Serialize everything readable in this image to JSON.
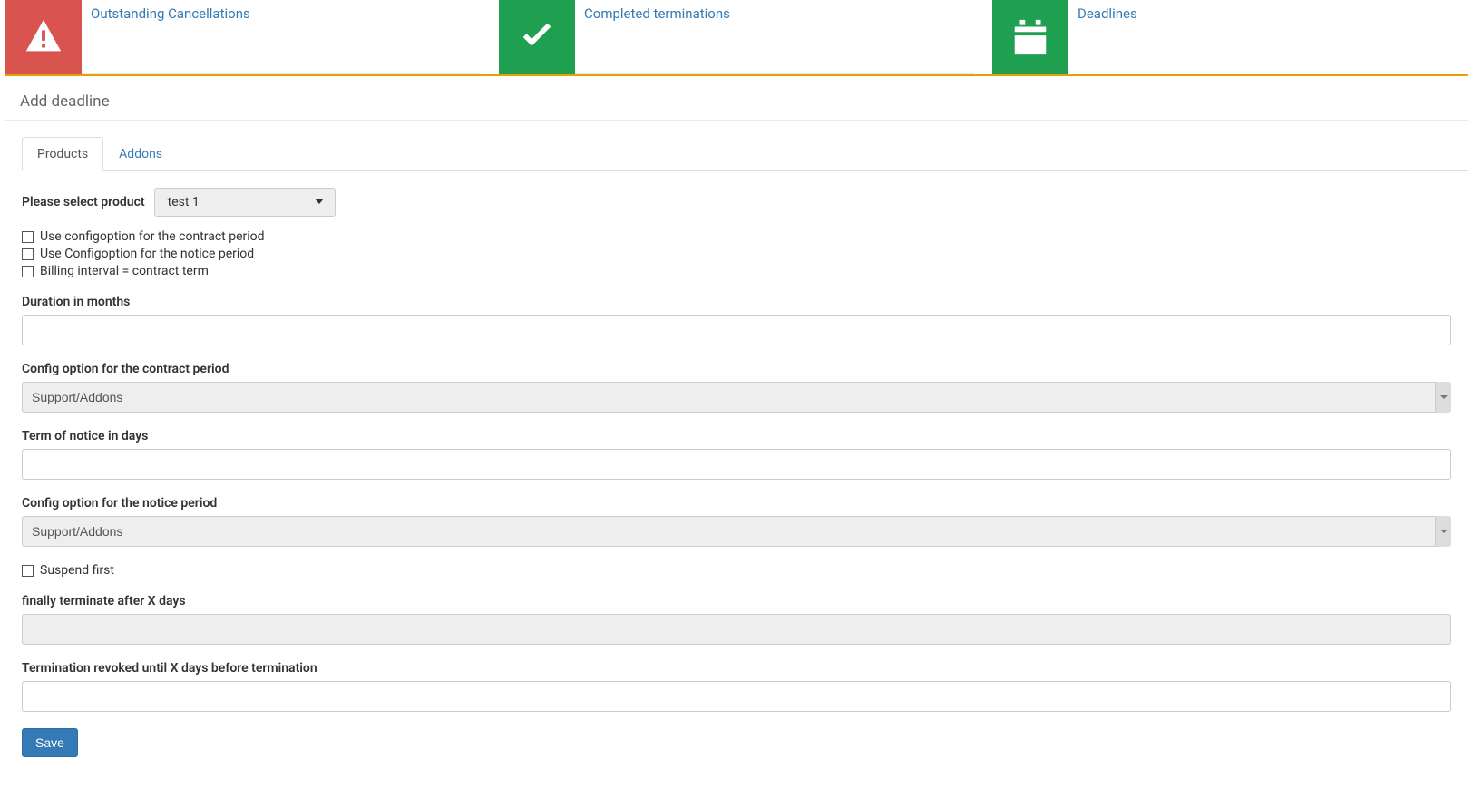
{
  "cards": {
    "outstanding": {
      "title": "Outstanding Cancellations"
    },
    "completed": {
      "title": "Completed terminations"
    },
    "deadlines": {
      "title": "Deadlines"
    }
  },
  "panel": {
    "heading": "Add deadline"
  },
  "tabs": {
    "products": "Products",
    "addons": "Addons"
  },
  "form": {
    "select_product_label": "Please select product",
    "select_product_value": "test 1",
    "chk_config_contract": "Use configoption for the contract period",
    "chk_config_notice": "Use Configoption for the notice period",
    "chk_billing_interval": "Billing interval = contract term",
    "duration_label": "Duration in months",
    "duration_value": "",
    "config_contract_label": "Config option for the contract period",
    "config_contract_value": "Support/Addons",
    "term_notice_label": "Term of notice in days",
    "term_notice_value": "",
    "config_notice_label": "Config option for the notice period",
    "config_notice_value": "Support/Addons",
    "chk_suspend_first": "Suspend first",
    "finally_terminate_label": "finally terminate after X days",
    "finally_terminate_value": "",
    "revoked_label": "Termination revoked until X days before termination",
    "revoked_value": "",
    "save_button": "Save"
  }
}
